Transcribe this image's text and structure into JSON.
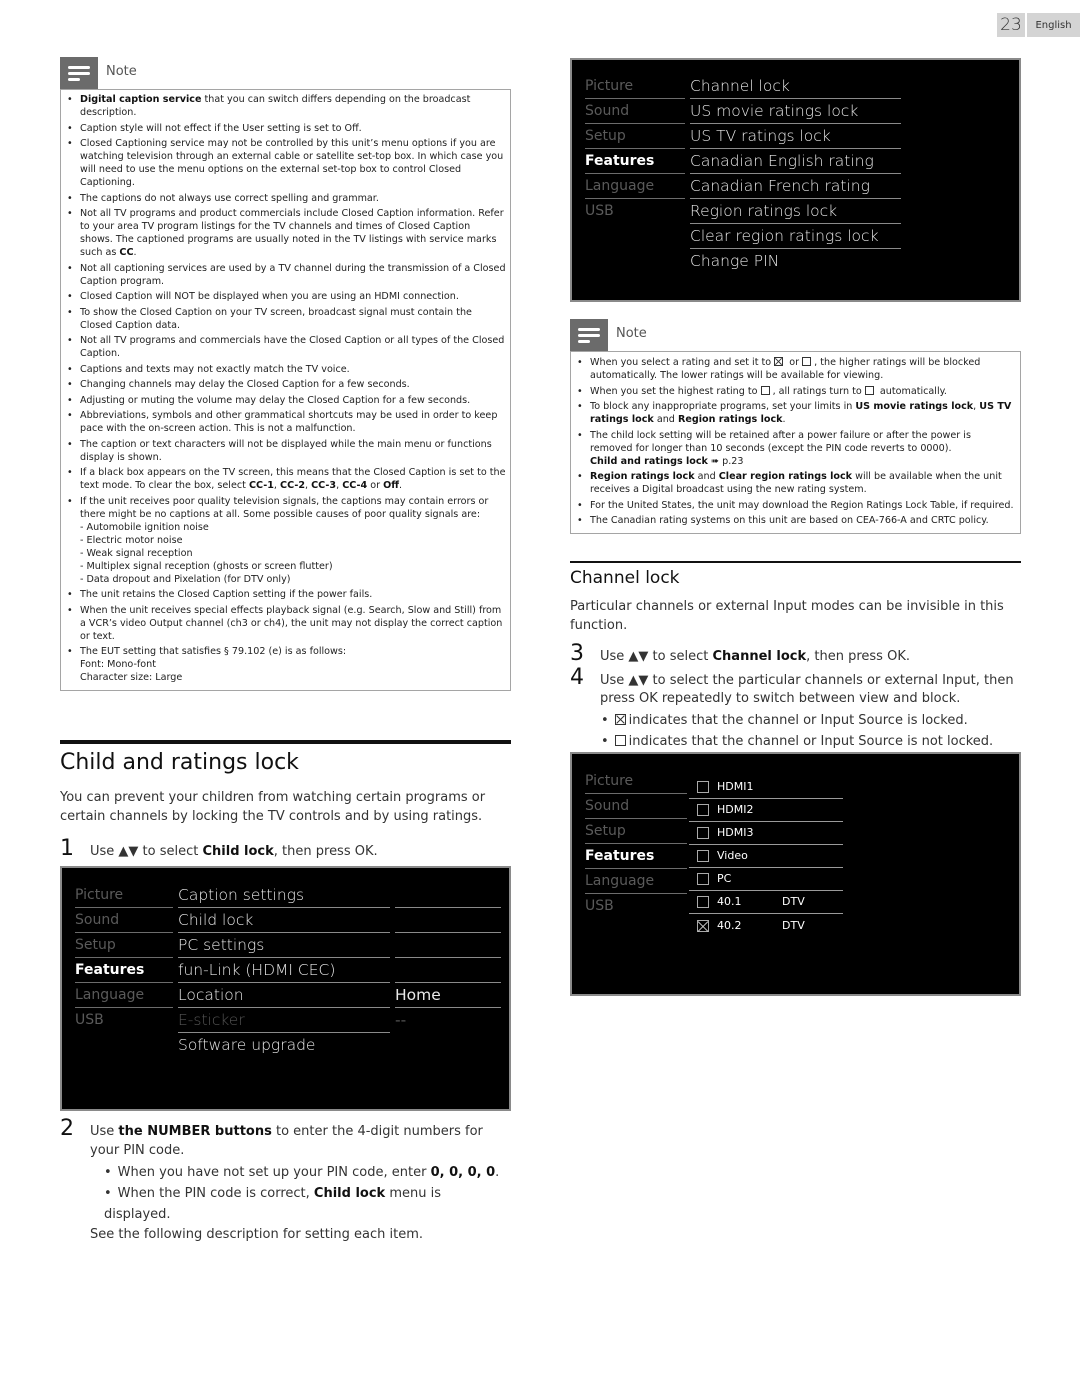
{
  "page": {
    "number": "23",
    "language": "English"
  },
  "left_note": {
    "title": "Note",
    "items": [
      {
        "bold": "Digital caption service",
        "text": " that you can switch differs depending on the broadcast description."
      },
      {
        "text": "Caption style will not effect if the User setting is set to Off."
      },
      {
        "text": "Closed Captioning service may not be controlled by this unit’s menu options if you are watching television through an external cable or satellite set-top box. In which case you will need to use the menu options on the external set-top box to control Closed Captioning."
      },
      {
        "text": "The captions do not always use correct spelling and grammar."
      },
      {
        "text": "Not all TV programs and product commercials include Closed Caption information. Refer to your area TV program listings for the TV channels and times of Closed Caption shows. The captioned programs are usually noted in the TV listings with service marks such as ",
        "bold_end": "CC",
        "tail": "."
      },
      {
        "text": "Not all captioning services are used by a TV channel during the transmission of a Closed Caption program."
      },
      {
        "text": "Closed Caption will NOT be displayed when you are using an HDMI connection."
      },
      {
        "text": "To show the Closed Caption on your TV screen, broadcast signal must contain the Closed Caption data."
      },
      {
        "text": "Not all TV programs and commercials have the Closed Caption or all types of the Closed Caption."
      },
      {
        "text": "Captions and texts may not exactly match the TV voice."
      },
      {
        "text": "Changing channels may delay the Closed Caption for a few seconds."
      },
      {
        "text": "Adjusting or muting the volume may delay the Closed Caption for a few seconds."
      },
      {
        "text": "Abbreviations, symbols and other grammatical shortcuts may be used in order to keep pace with the on-screen action. This is not a malfunction."
      },
      {
        "text": "The caption or text characters will not be displayed while the main menu or functions display is shown."
      },
      {
        "text": "If a black box appears on the TV screen, this means that the Closed Caption is set to the text mode. To clear the box, select ",
        "options": [
          "CC-1",
          "CC-2",
          "CC-3",
          "CC-4",
          "Off"
        ]
      },
      {
        "text": "If the unit receives poor quality television signals, the captions may contain errors or there might be no captions at all. Some possible causes of poor quality signals are:",
        "sub": [
          "- Automobile ignition noise",
          "- Electric motor noise",
          "- Weak signal reception",
          "- Multiplex signal reception (ghosts or screen flutter)",
          "- Data dropout and Pixelation (for DTV only)"
        ]
      },
      {
        "text": "The unit retains the Closed Caption setting if the power fails."
      },
      {
        "text": "When the unit receives special effects playback signal (e.g. Search, Slow and Still) from a VCR’s video Output channel (ch3 or ch4), the unit may not display the correct caption or text."
      },
      {
        "text": "The EUT setting that satisfies § 79.102 (e) is as follows:",
        "sub": [
          "Font: Mono-font",
          "Character size: Large"
        ]
      }
    ]
  },
  "child_lock_section": {
    "title": "Child and ratings lock",
    "intro": "You can prevent your children from watching certain programs or certain channels by locking the TV controls and by using ratings.",
    "step1": {
      "num": "1",
      "pre": "Use ▲▼ to select ",
      "bold": "Child lock",
      "post": ", then press OK."
    },
    "step2": {
      "num": "2",
      "pre": "Use ",
      "bold": "the NUMBER buttons",
      "post": " to enter the 4-digit numbers for your PIN code."
    },
    "step2_bullets": [
      {
        "pre": "When you have not set up your PIN code, enter ",
        "bold": "0, 0, 0, 0",
        "post": "."
      },
      {
        "pre": "When the PIN code is correct, ",
        "bold": "Child lock",
        "post": " menu is displayed."
      }
    ],
    "followup": "See the following description for setting each item."
  },
  "menu_features": {
    "categories": [
      {
        "label": "Picture",
        "active": false
      },
      {
        "label": "Sound",
        "active": false
      },
      {
        "label": "Setup",
        "active": false
      },
      {
        "label": "Features",
        "active": true
      },
      {
        "label": "Language",
        "active": false
      },
      {
        "label": "USB",
        "active": false
      }
    ],
    "items": [
      {
        "label": "Caption settings",
        "value": "",
        "dim": false
      },
      {
        "label": "Child lock",
        "value": "",
        "dim": false
      },
      {
        "label": "PC settings",
        "value": "",
        "dim": false
      },
      {
        "label": "fun-Link (HDMI CEC)",
        "value": "",
        "dim": false
      },
      {
        "label": "Location",
        "value": "Home",
        "dim": false
      },
      {
        "label": "E-sticker",
        "value": "--",
        "dim": true
      },
      {
        "label": "Software upgrade",
        "value": "",
        "dim": false
      }
    ]
  },
  "menu_child_lock": {
    "categories": [
      "Picture",
      "Sound",
      "Setup",
      "Features",
      "Language",
      "USB"
    ],
    "active_category": "Features",
    "items": [
      "Channel lock",
      "US movie ratings lock",
      "US TV ratings lock",
      "Canadian English rating",
      "Canadian French rating",
      "Region ratings lock",
      "Clear region ratings lock",
      "Change PIN"
    ]
  },
  "right_note": {
    "title": "Note",
    "items": [
      {
        "html_key": "a",
        "pre": "When you select a rating and set it to ",
        "mid": " or ",
        "post": ", the higher ratings will be blocked automatically. The lower ratings will be available for viewing."
      },
      {
        "html_key": "b",
        "pre": "When you set the highest rating to ",
        "mid": ", all ratings turn to ",
        "post": " automatically."
      },
      {
        "html_key": "c",
        "pre": "To block any inappropriate programs, set your limits in ",
        "b1": "US movie ratings lock",
        "sep1": ", ",
        "b2": "US TV ratings lock",
        "sep2": " and ",
        "b3": "Region ratings lock",
        "post": "."
      },
      {
        "html_key": "d",
        "pre": "The child lock setting will be retained after a power failure or after the power is removed for longer than 10 seconds (except the PIN code reverts to 0000).",
        "ref_bold": "Child and ratings lock",
        "ref_arrow": "➠",
        "ref_page": "p.23"
      },
      {
        "html_key": "e",
        "b1": "Region ratings lock",
        "sep1": " and ",
        "b2": "Clear region ratings lock",
        "post": " will be available when the unit receives a Digital broadcast using the new rating system."
      },
      {
        "html_key": "f",
        "pre": "For the United States, the unit may download the Region Ratings Lock Table, if required."
      },
      {
        "html_key": "g",
        "pre": "The Canadian rating systems on this unit are based on CEA-766-A and CRTC policy."
      }
    ]
  },
  "channel_lock_section": {
    "title": "Channel lock",
    "intro": "Particular channels or external Input modes can be invisible in this function.",
    "step3": {
      "num": "3",
      "pre": "Use ▲▼ to select ",
      "bold": "Channel lock",
      "post": ", then press OK."
    },
    "step4": {
      "num": "4",
      "text": "Use ▲▼ to select the particular channels or external Input, then press OK repeatedly to switch between view and block."
    },
    "legend": [
      {
        "checked": true,
        "text": "indicates that the channel or Input Source is locked."
      },
      {
        "checked": false,
        "text": "indicates that the channel or Input Source is not locked."
      }
    ]
  },
  "menu_channel_lock": {
    "categories": [
      "Picture",
      "Sound",
      "Setup",
      "Features",
      "Language",
      "USB"
    ],
    "active_category": "Features",
    "channels": [
      {
        "name": "HDMI1",
        "type": "",
        "locked": false
      },
      {
        "name": "HDMI2",
        "type": "",
        "locked": false
      },
      {
        "name": "HDMI3",
        "type": "",
        "locked": false
      },
      {
        "name": "Video",
        "type": "",
        "locked": false
      },
      {
        "name": "PC",
        "type": "",
        "locked": false
      },
      {
        "name": "40.1",
        "type": "DTV",
        "locked": false
      },
      {
        "name": "40.2",
        "type": "DTV",
        "locked": true
      }
    ]
  }
}
